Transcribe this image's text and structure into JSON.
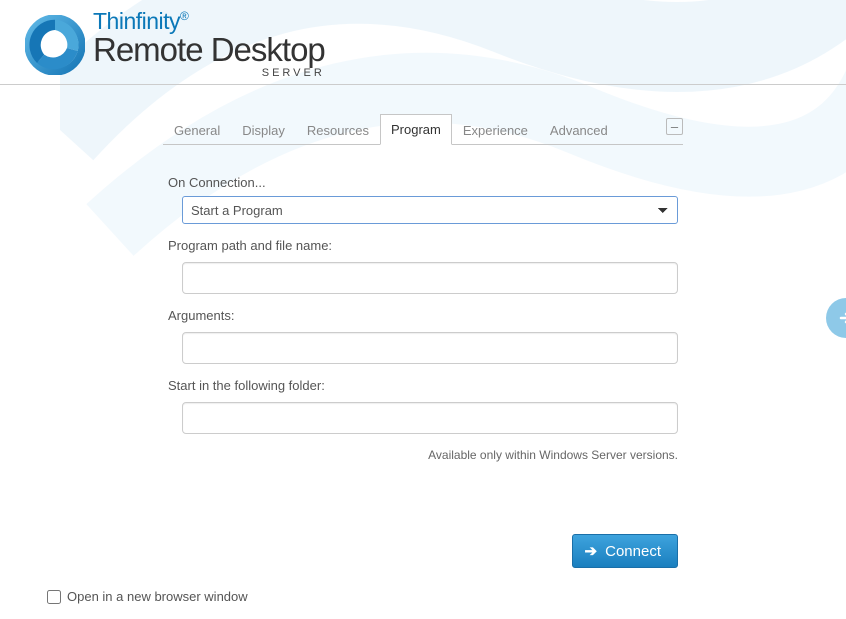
{
  "logo": {
    "line1": "Thinfinity",
    "mark_after": "®",
    "line2": "Remote Desktop",
    "server": "SERVER"
  },
  "tabs": {
    "0": {
      "label": "General"
    },
    "1": {
      "label": "Display"
    },
    "2": {
      "label": "Resources"
    },
    "3": {
      "label": "Program"
    },
    "4": {
      "label": "Experience"
    },
    "5": {
      "label": "Advanced"
    }
  },
  "collapse_symbol": "–",
  "form": {
    "on_connection_label": "On Connection...",
    "on_connection_value": "Start a Program",
    "path_label": "Program path and file name:",
    "path_value": "",
    "arguments_label": "Arguments:",
    "arguments_value": "",
    "folder_label": "Start in the following folder:",
    "folder_value": "",
    "note": "Available only within Windows Server versions."
  },
  "connect_label": "Connect",
  "open_window_label": "Open in a new browser window"
}
